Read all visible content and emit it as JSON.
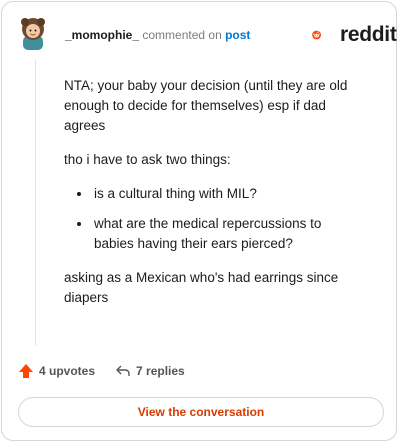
{
  "comment": {
    "username": "_momophie_",
    "action": "commented on",
    "target_link": "post",
    "paragraphs": [
      "NTA; your baby your decision (until they are old enough to decide for themselves) esp if dad agrees",
      "tho i have to ask two things:"
    ],
    "bullets": [
      "is a cultural thing with MIL?",
      "what are the medical repercussions to babies having their ears pierced?"
    ],
    "closing": "asking as a Mexican who's had earrings since diapers"
  },
  "brand": {
    "name": "reddit",
    "accent_color": "#ff4500"
  },
  "stats": {
    "upvotes": "4 upvotes",
    "replies": "7 replies"
  },
  "cta": {
    "label": "View the conversation"
  },
  "icons": {
    "upvote": "upvote-arrow-icon",
    "reply": "reply-arrow-icon",
    "logo": "reddit-snoo-icon"
  }
}
